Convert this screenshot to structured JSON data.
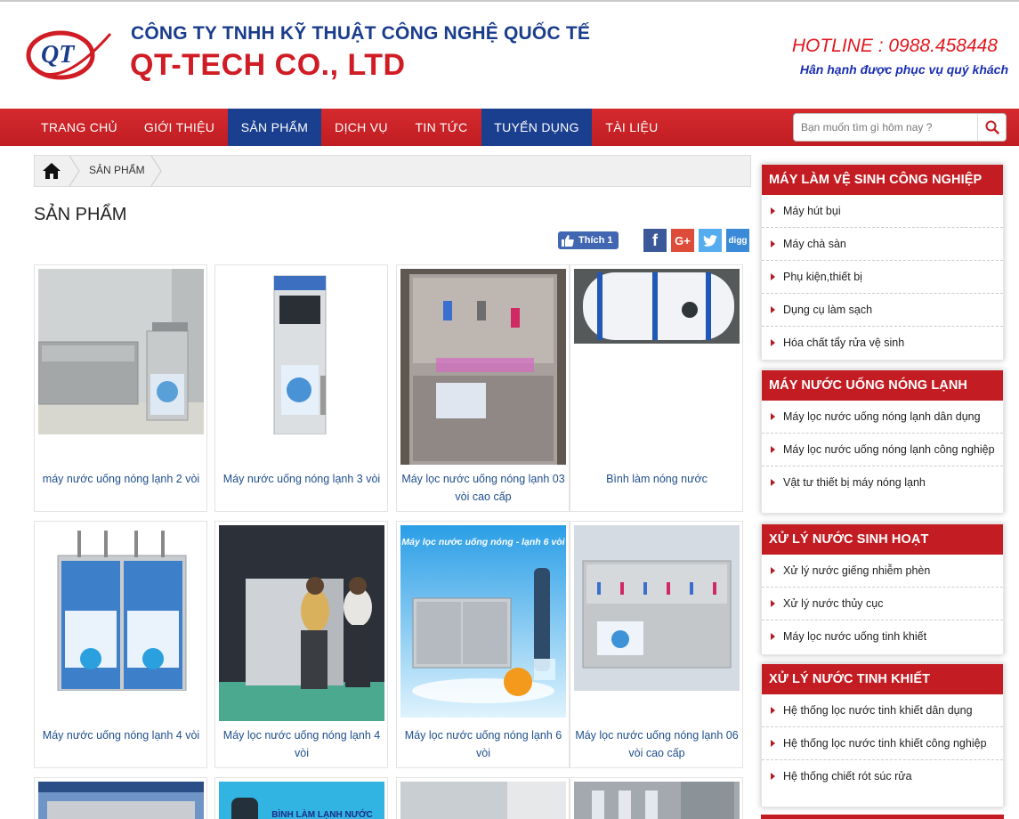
{
  "header": {
    "logo_text": "QT",
    "company_line1": "CÔNG TY TNHH KỸ THUẬT CÔNG NGHỆ QUỐC TẾ",
    "company_line2": "QT-TECH CO., LTD",
    "hotline": "HOTLINE : 0988.458448",
    "slogan": "Hân hạnh được phục vụ quý khách"
  },
  "nav": {
    "items": [
      "TRANG CHỦ",
      "GIỚI THIỆU",
      "SẢN PHẨM",
      "DỊCH VỤ",
      "TIN TỨC",
      "TUYỂN DỤNG",
      "TÀI LIỆU"
    ],
    "active": [
      "SẢN PHẨM",
      "TUYỂN DỤNG"
    ],
    "search_placeholder": "Bạn muốn tìm gì hôm nay ?"
  },
  "breadcrumb": {
    "current": "SẢN PHẨM"
  },
  "page": {
    "title": "SẢN PHẨM"
  },
  "social": {
    "like_label": "Thích 1",
    "buttons": [
      "f",
      "G+",
      "t",
      "digg"
    ],
    "colors": {
      "facebook": "#3b5998",
      "google": "#dd4b39",
      "twitter": "#55acee",
      "digg": "#3a8ad8"
    }
  },
  "products": [
    "máy nước uống nóng lạnh 2 vòi",
    "Máy nước uống nóng lạnh 3 vòi",
    "Máy lọc nước uống nóng lạnh 03 vòi cao cấp",
    "Bình làm nóng nước",
    "Máy nước uống nóng lạnh 4 vòi",
    "Máy lọc nước uống nóng lạnh 4 vòi",
    "Máy lọc nước uống nóng lạnh 6 vòi",
    "Máy lọc nước uống nóng lạnh 06 vòi cao cấp"
  ],
  "product_image_text": {
    "poster_6": "Máy lọc nước uống nóng - lạnh 6 vòi",
    "poster_bottom": "BÌNH LÀM LẠNH NƯỚC"
  },
  "sidebar": [
    {
      "title": "MÁY LÀM VỆ SINH CÔNG NGHIỆP",
      "items": [
        "Máy hút bụi",
        "Máy chà sàn",
        "Phụ kiện,thiết bị",
        "Dụng cụ làm sạch",
        "Hóa chất tẩy rửa vệ sinh"
      ]
    },
    {
      "title": "MÁY NƯỚC UỐNG NÓNG LẠNH",
      "items": [
        "Máy lọc nước uống nóng lạnh dân dụng",
        "Máy lọc nước uống nóng lạnh công nghiệp",
        "Vật tư thiết bị máy nóng lạnh"
      ]
    },
    {
      "title": "XỬ LÝ NƯỚC SINH HOẠT",
      "items": [
        "Xử lý nước giếng nhiễm phèn",
        "Xử lý nước thủy cục",
        "Máy lọc nước uống tinh khiết"
      ]
    },
    {
      "title": "XỬ LÝ NƯỚC TINH KHIẾT",
      "items": [
        "Hệ thống lọc nước tinh khiết dân dụng",
        "Hệ thống lọc nước tinh khiết công nghiệp",
        "Hệ thống chiết rót súc rửa"
      ]
    }
  ],
  "colors": {
    "brand_red": "#c31d23",
    "brand_blue": "#1b3f8f",
    "link_blue": "#1f4e8c"
  }
}
